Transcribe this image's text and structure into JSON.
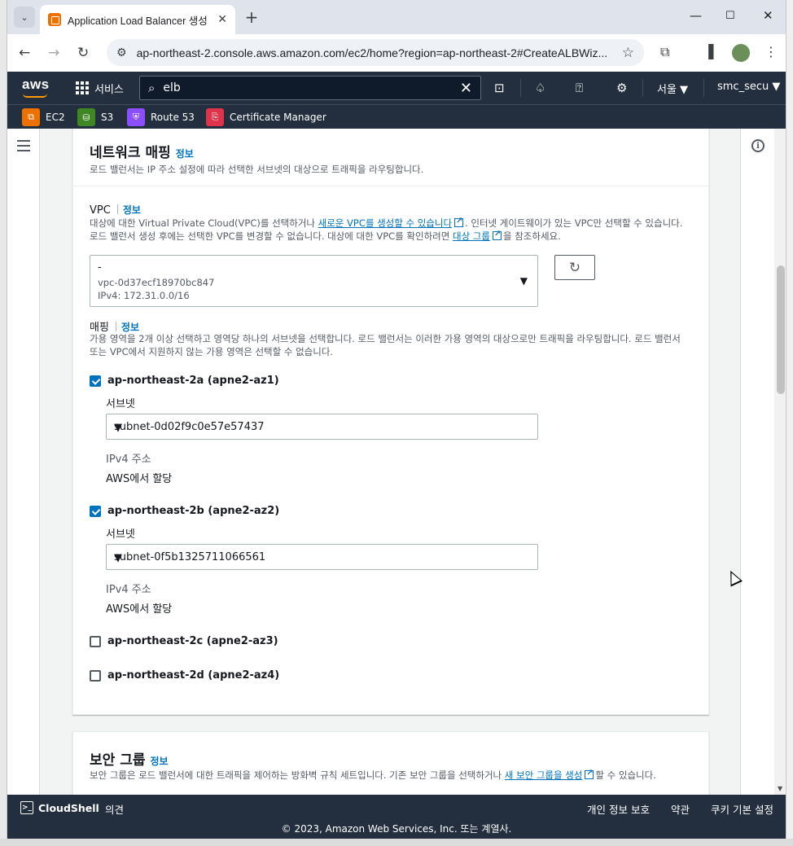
{
  "browser": {
    "tab_title": "Application Load Balancer 생성",
    "url": "ap-northeast-2.console.aws.amazon.com/ec2/home?region=ap-northeast-2#CreateALBWiz..."
  },
  "aws_nav": {
    "logo": "aws",
    "services_label": "서비스",
    "search_value": "elb",
    "region": "서울 ▼",
    "user": "smc_secu ▼"
  },
  "favorites": [
    {
      "label": "EC2",
      "color": "#ed7100"
    },
    {
      "label": "S3",
      "color": "#3f8624"
    },
    {
      "label": "Route 53",
      "color": "#8c4fff"
    },
    {
      "label": "Certificate Manager",
      "color": "#dd344c"
    }
  ],
  "network": {
    "title": "네트워크 매핑",
    "info": "정보",
    "desc": "로드 밸런서는 IP 주소 설정에 따라 선택한 서브넷의 대상으로 트래픽을 라우팅합니다.",
    "vpc": {
      "label": "VPC",
      "info": "정보",
      "desc_1": "대상에 대한 Virtual Private Cloud(VPC)를 선택하거나 ",
      "desc_link_1": "새로운 VPC를 생성할 수 있습니다",
      "desc_2": ". 인터넷 게이트웨이가 있는 VPC만 선택할 수 있습니다. 로드 밸런서 생성 후에는 선택한 VPC를 변경할 수 없습니다. 대상에 대한 VPC를 확인하려면 ",
      "desc_link_2": "대상 그룹",
      "desc_3": "을 참조하세요.",
      "selected_name": "-",
      "selected_id": "vpc-0d37ecf18970bc847",
      "selected_cidr": "IPv4: 172.31.0.0/16"
    },
    "mapping": {
      "label": "매핑",
      "info": "정보",
      "desc": "가용 영역을 2개 이상 선택하고 영역당 하나의 서브넷을 선택합니다. 로드 밸런서는 이러한 가용 영역의 대상으로만 트래픽을 라우팅합니다. 로드 밸런서 또는 VPC에서 지원하지 않는 가용 영역은 선택할 수 없습니다.",
      "zones": [
        {
          "name": "ap-northeast-2a (apne2-az1)",
          "checked": true,
          "subnet_label": "서브넷",
          "subnet": "subnet-0d02f9c0e57e57437",
          "ipv4_label": "IPv4 주소",
          "ipv4_value": "AWS에서 할당"
        },
        {
          "name": "ap-northeast-2b (apne2-az2)",
          "checked": true,
          "subnet_label": "서브넷",
          "subnet": "subnet-0f5b1325711066561",
          "ipv4_label": "IPv4 주소",
          "ipv4_value": "AWS에서 할당"
        },
        {
          "name": "ap-northeast-2c (apne2-az3)",
          "checked": false
        },
        {
          "name": "ap-northeast-2d (apne2-az4)",
          "checked": false
        }
      ]
    }
  },
  "security": {
    "title": "보안 그룹",
    "info": "정보",
    "desc_1": "보안 그룹은 로드 밸런서에 대한 트래픽을 제어하는 방화벽 규칙 세트입니다. 기존 보안 그룹을 선택하거나 ",
    "desc_link": "새 보안 그룹을 생성",
    "desc_2": "할 수 있습니다."
  },
  "footer": {
    "cloudshell": "CloudShell",
    "feedback": "의견",
    "privacy": "개인 정보 보호",
    "terms": "약관",
    "cookies": "쿠키 기본 설정",
    "copyright": "© 2023, Amazon Web Services, Inc. 또는 계열사."
  },
  "colors": {
    "aws_nav": "#232f3e",
    "link": "#0073bb",
    "accent": "#ff9900"
  }
}
